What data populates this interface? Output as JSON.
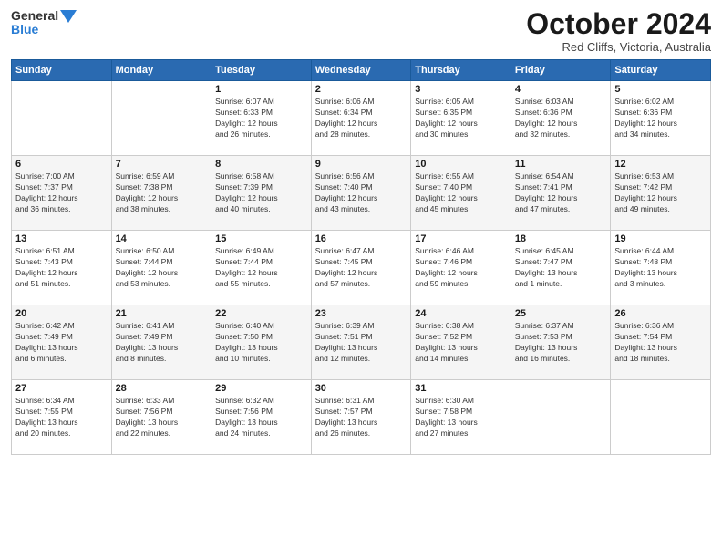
{
  "header": {
    "logo_line1": "General",
    "logo_line2": "Blue",
    "month": "October 2024",
    "location": "Red Cliffs, Victoria, Australia"
  },
  "weekdays": [
    "Sunday",
    "Monday",
    "Tuesday",
    "Wednesday",
    "Thursday",
    "Friday",
    "Saturday"
  ],
  "weeks": [
    [
      {
        "day": "",
        "info": ""
      },
      {
        "day": "",
        "info": ""
      },
      {
        "day": "1",
        "info": "Sunrise: 6:07 AM\nSunset: 6:33 PM\nDaylight: 12 hours\nand 26 minutes."
      },
      {
        "day": "2",
        "info": "Sunrise: 6:06 AM\nSunset: 6:34 PM\nDaylight: 12 hours\nand 28 minutes."
      },
      {
        "day": "3",
        "info": "Sunrise: 6:05 AM\nSunset: 6:35 PM\nDaylight: 12 hours\nand 30 minutes."
      },
      {
        "day": "4",
        "info": "Sunrise: 6:03 AM\nSunset: 6:36 PM\nDaylight: 12 hours\nand 32 minutes."
      },
      {
        "day": "5",
        "info": "Sunrise: 6:02 AM\nSunset: 6:36 PM\nDaylight: 12 hours\nand 34 minutes."
      }
    ],
    [
      {
        "day": "6",
        "info": "Sunrise: 7:00 AM\nSunset: 7:37 PM\nDaylight: 12 hours\nand 36 minutes."
      },
      {
        "day": "7",
        "info": "Sunrise: 6:59 AM\nSunset: 7:38 PM\nDaylight: 12 hours\nand 38 minutes."
      },
      {
        "day": "8",
        "info": "Sunrise: 6:58 AM\nSunset: 7:39 PM\nDaylight: 12 hours\nand 40 minutes."
      },
      {
        "day": "9",
        "info": "Sunrise: 6:56 AM\nSunset: 7:40 PM\nDaylight: 12 hours\nand 43 minutes."
      },
      {
        "day": "10",
        "info": "Sunrise: 6:55 AM\nSunset: 7:40 PM\nDaylight: 12 hours\nand 45 minutes."
      },
      {
        "day": "11",
        "info": "Sunrise: 6:54 AM\nSunset: 7:41 PM\nDaylight: 12 hours\nand 47 minutes."
      },
      {
        "day": "12",
        "info": "Sunrise: 6:53 AM\nSunset: 7:42 PM\nDaylight: 12 hours\nand 49 minutes."
      }
    ],
    [
      {
        "day": "13",
        "info": "Sunrise: 6:51 AM\nSunset: 7:43 PM\nDaylight: 12 hours\nand 51 minutes."
      },
      {
        "day": "14",
        "info": "Sunrise: 6:50 AM\nSunset: 7:44 PM\nDaylight: 12 hours\nand 53 minutes."
      },
      {
        "day": "15",
        "info": "Sunrise: 6:49 AM\nSunset: 7:44 PM\nDaylight: 12 hours\nand 55 minutes."
      },
      {
        "day": "16",
        "info": "Sunrise: 6:47 AM\nSunset: 7:45 PM\nDaylight: 12 hours\nand 57 minutes."
      },
      {
        "day": "17",
        "info": "Sunrise: 6:46 AM\nSunset: 7:46 PM\nDaylight: 12 hours\nand 59 minutes."
      },
      {
        "day": "18",
        "info": "Sunrise: 6:45 AM\nSunset: 7:47 PM\nDaylight: 13 hours\nand 1 minute."
      },
      {
        "day": "19",
        "info": "Sunrise: 6:44 AM\nSunset: 7:48 PM\nDaylight: 13 hours\nand 3 minutes."
      }
    ],
    [
      {
        "day": "20",
        "info": "Sunrise: 6:42 AM\nSunset: 7:49 PM\nDaylight: 13 hours\nand 6 minutes."
      },
      {
        "day": "21",
        "info": "Sunrise: 6:41 AM\nSunset: 7:49 PM\nDaylight: 13 hours\nand 8 minutes."
      },
      {
        "day": "22",
        "info": "Sunrise: 6:40 AM\nSunset: 7:50 PM\nDaylight: 13 hours\nand 10 minutes."
      },
      {
        "day": "23",
        "info": "Sunrise: 6:39 AM\nSunset: 7:51 PM\nDaylight: 13 hours\nand 12 minutes."
      },
      {
        "day": "24",
        "info": "Sunrise: 6:38 AM\nSunset: 7:52 PM\nDaylight: 13 hours\nand 14 minutes."
      },
      {
        "day": "25",
        "info": "Sunrise: 6:37 AM\nSunset: 7:53 PM\nDaylight: 13 hours\nand 16 minutes."
      },
      {
        "day": "26",
        "info": "Sunrise: 6:36 AM\nSunset: 7:54 PM\nDaylight: 13 hours\nand 18 minutes."
      }
    ],
    [
      {
        "day": "27",
        "info": "Sunrise: 6:34 AM\nSunset: 7:55 PM\nDaylight: 13 hours\nand 20 minutes."
      },
      {
        "day": "28",
        "info": "Sunrise: 6:33 AM\nSunset: 7:56 PM\nDaylight: 13 hours\nand 22 minutes."
      },
      {
        "day": "29",
        "info": "Sunrise: 6:32 AM\nSunset: 7:56 PM\nDaylight: 13 hours\nand 24 minutes."
      },
      {
        "day": "30",
        "info": "Sunrise: 6:31 AM\nSunset: 7:57 PM\nDaylight: 13 hours\nand 26 minutes."
      },
      {
        "day": "31",
        "info": "Sunrise: 6:30 AM\nSunset: 7:58 PM\nDaylight: 13 hours\nand 27 minutes."
      },
      {
        "day": "",
        "info": ""
      },
      {
        "day": "",
        "info": ""
      }
    ]
  ]
}
